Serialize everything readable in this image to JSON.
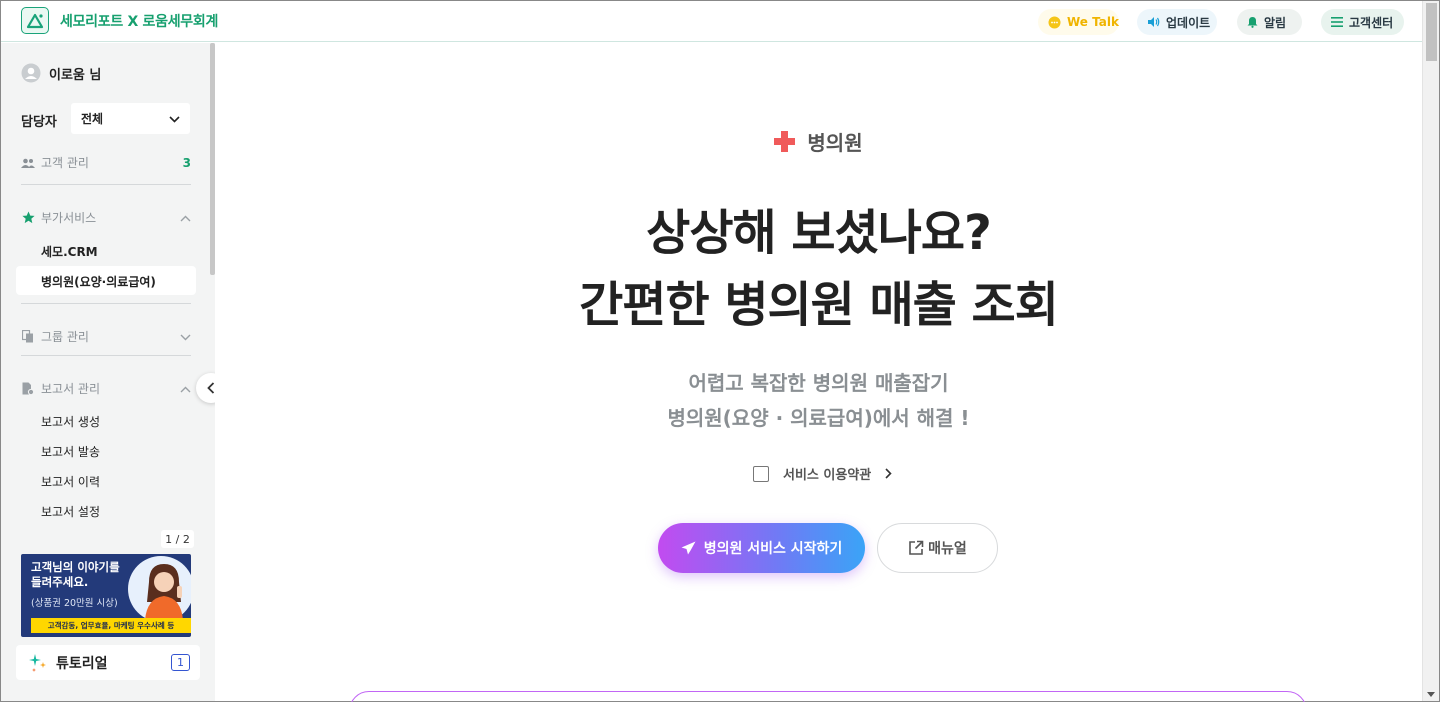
{
  "header": {
    "brand": "세모리포트 X 로움세무회계",
    "wetalk": "We Talk",
    "update": "업데이트",
    "alarm": "알림",
    "support": "고객센터"
  },
  "sidebar": {
    "user_name": "이로움 님",
    "manager_label": "담당자",
    "manager_value": "전체",
    "customer_mgmt": "고객 관리",
    "customer_count": "3",
    "addon_services": "부가서비스",
    "addon_items": [
      "세모.CRM",
      "병의원(요양·의료급여)"
    ],
    "group_mgmt": "그룹 관리",
    "report_mgmt": "보고서 관리",
    "report_items": [
      "보고서 생성",
      "보고서 발송",
      "보고서 이력",
      "보고서 설정"
    ],
    "page_indicator": "1 / 2",
    "banner": {
      "line1": "고객님의 이야기를",
      "line2": "들려주세요.",
      "line3": "(상품권 20만원 시상)",
      "line4": "고객감동, 업무효율, 마케팅 우수사례 등"
    },
    "tutorial_label": "튜토리얼",
    "tutorial_badge": "1"
  },
  "main": {
    "category": "병의원",
    "headline1": "상상해 보셨나요?",
    "headline2": "간편한 병의원 매출 조회",
    "sub1": "어렵고 복잡한 병의원 매출잡기",
    "sub2": "병의원(요양 · 의료급여)에서 해결 !",
    "terms": "서비스 이용약관",
    "start_button": "병의원 서비스 시작하기",
    "manual_button": "매뉴얼"
  },
  "colors": {
    "brand_green": "#17a06f",
    "accent_red": "#f05a5a",
    "gradient_start": "#c24bf0",
    "gradient_end": "#3aa4f7"
  }
}
